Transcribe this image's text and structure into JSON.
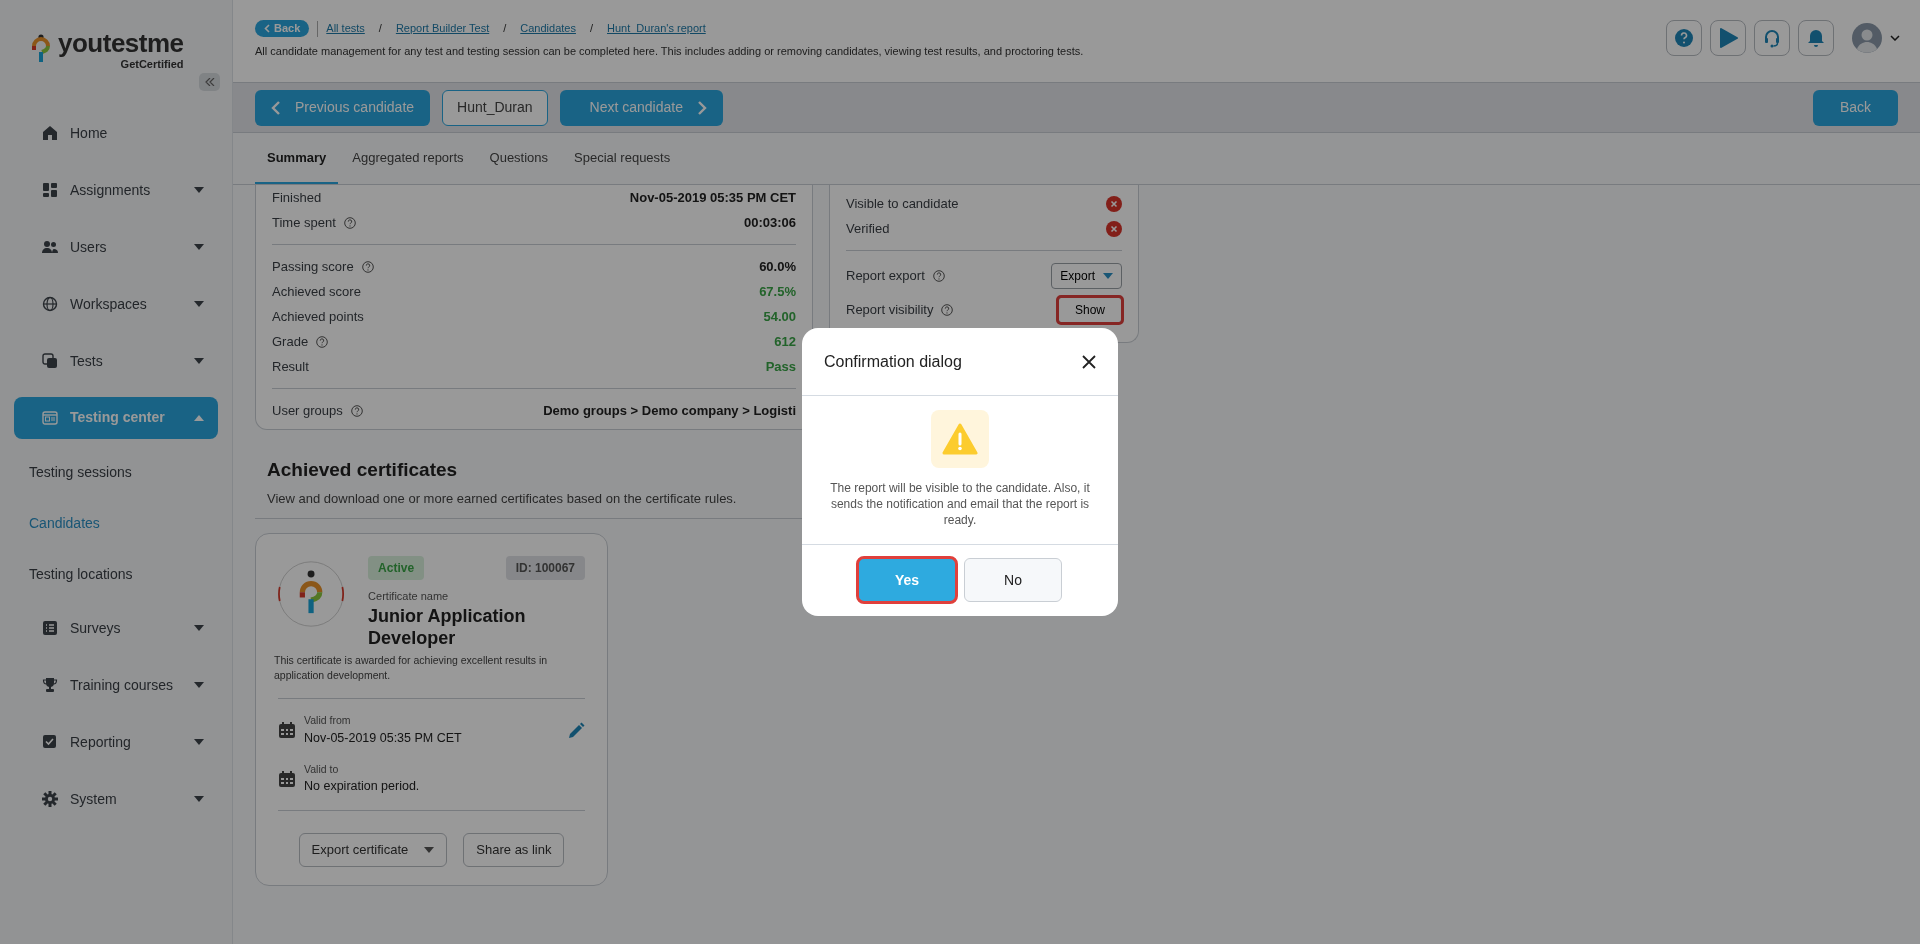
{
  "sidebar": {
    "logo": {
      "name": "youtestme",
      "tagline": "GetCertified"
    },
    "items": [
      {
        "label": "Home",
        "selected": false
      },
      {
        "label": "Assignments",
        "selected": false,
        "expanded": false
      },
      {
        "label": "Users",
        "selected": false,
        "expanded": false
      },
      {
        "label": "Workspaces",
        "selected": false,
        "expanded": false
      },
      {
        "label": "Tests",
        "selected": false,
        "expanded": false
      },
      {
        "label": "Testing center",
        "selected": true,
        "expanded": true,
        "children": [
          {
            "label": "Testing sessions",
            "selected": false
          },
          {
            "label": "Candidates",
            "selected": true
          },
          {
            "label": "Testing locations",
            "selected": false
          }
        ]
      },
      {
        "label": "Surveys",
        "selected": false,
        "expanded": false
      },
      {
        "label": "Training courses",
        "selected": false,
        "expanded": false
      },
      {
        "label": "Reporting",
        "selected": false,
        "expanded": false
      },
      {
        "label": "System",
        "selected": false,
        "expanded": false
      }
    ]
  },
  "header": {
    "back": "Back",
    "separator": "/",
    "breadcrumbs": [
      "All tests",
      "Report Builder Test",
      "Candidates",
      "Hunt_Duran's report"
    ],
    "description": "All candidate management for any test and testing session can be completed here. This includes adding or removing candidates, viewing test results, and proctoring tests."
  },
  "toolbar": {
    "previous": "Previous candidate",
    "candidate": "Hunt_Duran",
    "next": "Next candidate",
    "back": "Back"
  },
  "tabs": [
    {
      "label": "Summary",
      "selected": true
    },
    {
      "label": "Aggregated reports",
      "selected": false
    },
    {
      "label": "Questions",
      "selected": false
    },
    {
      "label": "Special requests",
      "selected": false
    }
  ],
  "summary": {
    "sections": [
      [
        {
          "label": "Finished",
          "help": false,
          "value": "Nov-05-2019 05:35 PM CET",
          "positive": false
        },
        {
          "label": "Time spent",
          "help": true,
          "value": "00:03:06",
          "positive": false
        }
      ],
      [
        {
          "label": "Passing score",
          "help": true,
          "value": "60.0%",
          "positive": false
        },
        {
          "label": "Achieved score",
          "help": false,
          "value": "67.5%",
          "positive": true
        },
        {
          "label": "Achieved points",
          "help": false,
          "value": "54.00",
          "positive": true
        },
        {
          "label": "Grade",
          "help": true,
          "value": "612",
          "positive": true
        },
        {
          "label": "Result",
          "help": false,
          "value": "Pass",
          "positive": true
        }
      ],
      [
        {
          "label": "User groups",
          "help": true,
          "value": "Demo groups > Demo company > Logisti",
          "positive": false
        }
      ]
    ]
  },
  "status": {
    "flags": [
      {
        "label": "Visible to candidate",
        "ok": false
      },
      {
        "label": "Verified",
        "ok": false
      }
    ],
    "actions": [
      {
        "label": "Report export",
        "help": true,
        "kind": "dropdown",
        "text": "Export",
        "highlighted": false
      },
      {
        "label": "Report visibility",
        "help": true,
        "kind": "button",
        "text": "Show",
        "highlighted": true
      }
    ]
  },
  "certificates": {
    "title": "Achieved certificates",
    "subtitle": "View and download one or more earned certificates based on the certificate rules.",
    "cards": [
      {
        "status": "Active",
        "id": "ID: 100067",
        "name_label": "Certificate name",
        "name": "Junior Application Developer",
        "description": "This certificate is awarded for achieving excellent results in application development.",
        "valid_from_label": "Valid from",
        "valid_from": "Nov-05-2019 05:35 PM CET",
        "valid_to_label": "Valid to",
        "valid_to": "No expiration period.",
        "buttons": [
          {
            "label": "Export certificate",
            "caret": true
          },
          {
            "label": "Share as link",
            "caret": false
          }
        ]
      }
    ]
  },
  "dialog": {
    "modal": true,
    "title": "Confirmation dialog",
    "message": "The report will be visible to the candidate. Also, it sends the notification and email that the report is ready.",
    "buttons": [
      {
        "label": "Yes",
        "kind": "primary",
        "highlighted": true
      },
      {
        "label": "No",
        "kind": "secondary",
        "highlighted": false
      }
    ]
  }
}
